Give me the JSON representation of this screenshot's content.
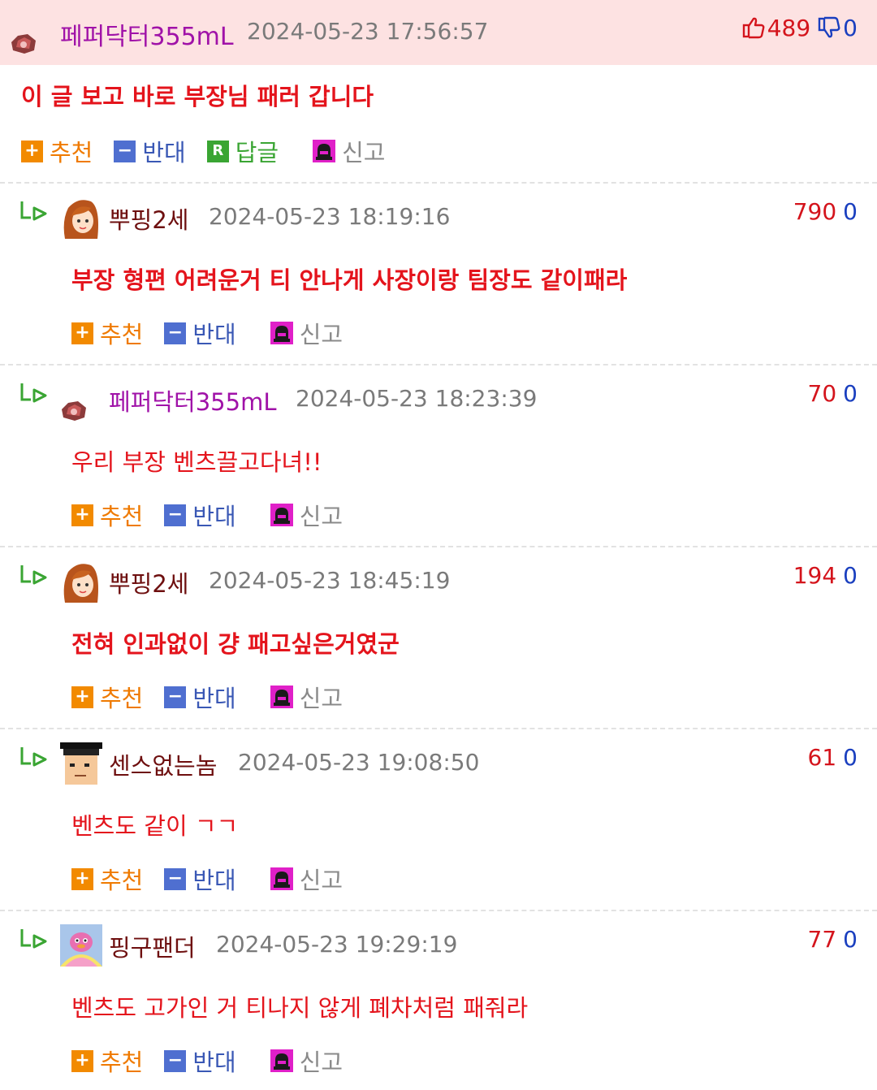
{
  "main_comment": {
    "author": "페퍼닥터355mL",
    "date": "2024-05-23 17:56:57",
    "likes": "489",
    "dislikes": "0",
    "body": "이 글 보고 바로 부장님 패러 갑니다",
    "actions": {
      "recommend": "추천",
      "oppose": "반대",
      "reply": "답글",
      "report": "신고"
    }
  },
  "replies": [
    {
      "author": "뿌핑2세",
      "date": "2024-05-23 18:19:16",
      "likes": "790",
      "dislikes": "0",
      "body": "부장 형편 어려운거 티 안나게 사장이랑 팀장도 같이패라",
      "actions": {
        "recommend": "추천",
        "oppose": "반대",
        "report": "신고"
      }
    },
    {
      "author": "페퍼닥터355mL",
      "date": "2024-05-23 18:23:39",
      "likes": "70",
      "dislikes": "0",
      "body": "우리 부장 벤츠끌고다녀!!",
      "actions": {
        "recommend": "추천",
        "oppose": "반대",
        "report": "신고"
      }
    },
    {
      "author": "뿌핑2세",
      "date": "2024-05-23 18:45:19",
      "likes": "194",
      "dislikes": "0",
      "body": "전혀 인과없이 걍 패고싶은거였군",
      "actions": {
        "recommend": "추천",
        "oppose": "반대",
        "report": "신고"
      }
    },
    {
      "author": "센스없는놈",
      "date": "2024-05-23 19:08:50",
      "likes": "61",
      "dislikes": "0",
      "body": "벤츠도 같이 ㄱㄱ",
      "actions": {
        "recommend": "추천",
        "oppose": "반대",
        "report": "신고"
      }
    },
    {
      "author": "핑구팬더",
      "date": "2024-05-23 19:29:19",
      "likes": "77",
      "dislikes": "0",
      "body": "벤츠도 고가인 거 티나지 않게 폐차처럼 패줘라",
      "actions": {
        "recommend": "추천",
        "oppose": "반대",
        "report": "신고"
      }
    }
  ],
  "icons": {
    "recommend": "plus-box-icon",
    "oppose": "minus-box-icon",
    "reply": "r-box-icon",
    "report": "siren-icon",
    "reply_indicator": "reply-arrow-icon",
    "thumb_up": "thumbs-up-icon",
    "thumb_down": "thumbs-down-icon"
  },
  "colors": {
    "header_bg": "#fde2e2",
    "author_purple": "#a012a8",
    "author_brown": "#6e0f0f",
    "body_red": "#e4141c",
    "likes_red": "#d4141c",
    "dislikes_blue": "#1a3fbf",
    "recommend_orange": "#f28a00",
    "oppose_blue": "#4f6fd0",
    "reply_green": "#3aa533",
    "report_magenta": "#e020c8"
  }
}
